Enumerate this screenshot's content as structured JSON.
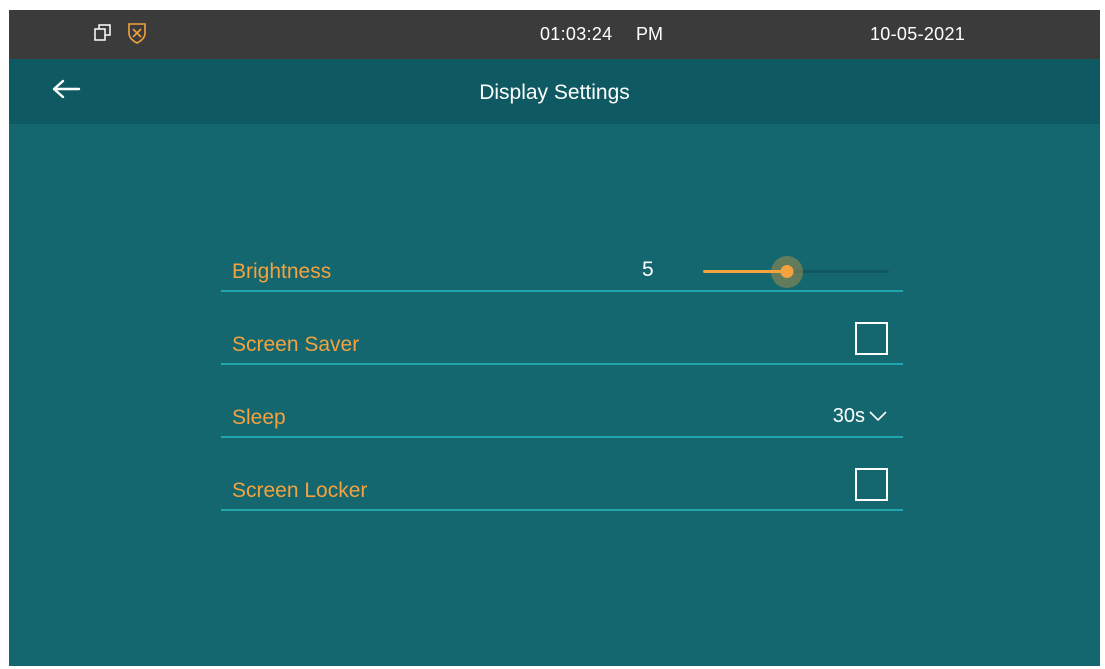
{
  "status_bar": {
    "time": "01:03:24",
    "ampm": "PM",
    "date": "10-05-2021",
    "icons": [
      "window-restore-icon",
      "shield-icon"
    ]
  },
  "header": {
    "title": "Display Settings",
    "back_icon": "arrow-left-icon"
  },
  "settings": {
    "brightness": {
      "label": "Brightness",
      "value": "5",
      "level_fraction": 0.45
    },
    "screen_saver": {
      "label": "Screen Saver",
      "checked": false
    },
    "sleep": {
      "label": "Sleep",
      "selected": "30s"
    },
    "screen_locker": {
      "label": "Screen Locker",
      "checked": false
    }
  },
  "colors": {
    "background": "#14666f",
    "header": "#0f5a62",
    "status_bar": "#3b3b3b",
    "accent": "#f4a23d",
    "divider": "#21a5ad"
  }
}
